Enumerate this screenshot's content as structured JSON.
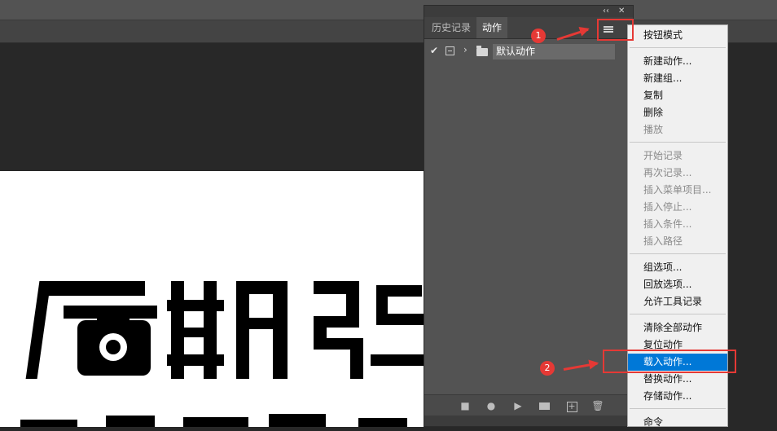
{
  "panel": {
    "header_buttons": [
      "‹‹",
      "✕"
    ],
    "tabs": [
      {
        "label": "历史记录",
        "active": false
      },
      {
        "label": "动作",
        "active": true
      }
    ],
    "action_row": {
      "checked": true,
      "name": "默认动作"
    },
    "footer_icons": [
      "stop-icon",
      "record-icon",
      "play-icon",
      "folder-icon",
      "new-action-icon",
      "trash-icon"
    ]
  },
  "menu": {
    "items": [
      {
        "label": "按钮模式",
        "disabled": false
      },
      {
        "label": "新建动作...",
        "disabled": false
      },
      {
        "label": "新建组...",
        "disabled": false
      },
      {
        "label": "复制",
        "disabled": false
      },
      {
        "label": "删除",
        "disabled": false
      },
      {
        "label": "播放",
        "disabled": true
      },
      {
        "label": "开始记录",
        "disabled": true
      },
      {
        "label": "再次记录...",
        "disabled": true
      },
      {
        "label": "插入菜单项目...",
        "disabled": true
      },
      {
        "label": "插入停止...",
        "disabled": true
      },
      {
        "label": "插入条件...",
        "disabled": true
      },
      {
        "label": "插入路径",
        "disabled": true
      },
      {
        "label": "组选项...",
        "disabled": false
      },
      {
        "label": "回放选项...",
        "disabled": false
      },
      {
        "label": "允许工具记录",
        "disabled": false
      },
      {
        "label": "清除全部动作",
        "disabled": false
      },
      {
        "label": "复位动作",
        "disabled": false
      },
      {
        "label": "载入动作...",
        "disabled": false,
        "highlighted": true
      },
      {
        "label": "替换动作...",
        "disabled": false
      },
      {
        "label": "存储动作...",
        "disabled": false
      },
      {
        "label": "命令",
        "disabled": false
      }
    ]
  },
  "annotations": {
    "badge1": "1",
    "badge2": "2",
    "color": "#e53935"
  },
  "colors": {
    "app_bg": "#282828",
    "panel_bg": "#535353",
    "menu_bg": "#f0f0f0",
    "highlight": "#0078d7"
  }
}
